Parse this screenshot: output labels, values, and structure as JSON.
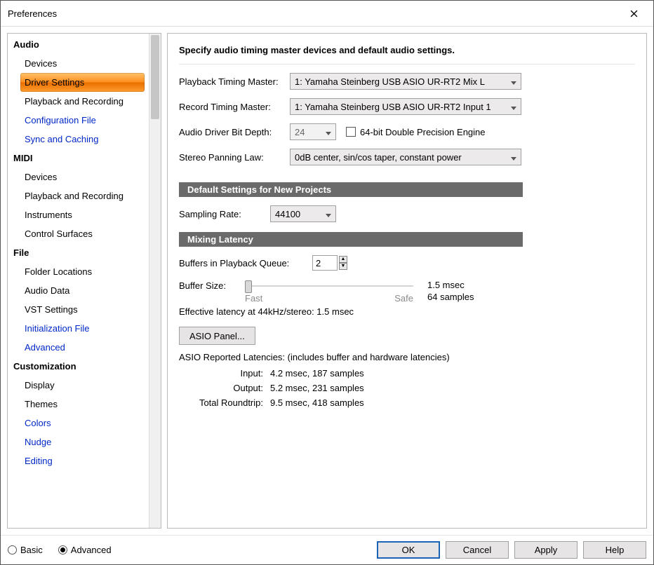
{
  "window": {
    "title": "Preferences"
  },
  "sidebar": {
    "sections": [
      {
        "header": "Audio",
        "items": [
          {
            "label": "Devices",
            "link": false,
            "selected": false
          },
          {
            "label": "Driver Settings",
            "link": false,
            "selected": true
          },
          {
            "label": "Playback and Recording",
            "link": false,
            "selected": false
          },
          {
            "label": "Configuration File",
            "link": true,
            "selected": false
          },
          {
            "label": "Sync and Caching",
            "link": true,
            "selected": false
          }
        ]
      },
      {
        "header": "MIDI",
        "items": [
          {
            "label": "Devices",
            "link": false,
            "selected": false
          },
          {
            "label": "Playback and Recording",
            "link": false,
            "selected": false
          },
          {
            "label": "Instruments",
            "link": false,
            "selected": false
          },
          {
            "label": "Control Surfaces",
            "link": false,
            "selected": false
          }
        ]
      },
      {
        "header": "File",
        "items": [
          {
            "label": "Folder Locations",
            "link": false,
            "selected": false
          },
          {
            "label": "Audio Data",
            "link": false,
            "selected": false
          },
          {
            "label": "VST Settings",
            "link": false,
            "selected": false
          },
          {
            "label": "Initialization File",
            "link": true,
            "selected": false
          },
          {
            "label": "Advanced",
            "link": true,
            "selected": false
          }
        ]
      },
      {
        "header": "Customization",
        "items": [
          {
            "label": "Display",
            "link": false,
            "selected": false
          },
          {
            "label": "Themes",
            "link": false,
            "selected": false
          },
          {
            "label": "Colors",
            "link": true,
            "selected": false
          },
          {
            "label": "Nudge",
            "link": true,
            "selected": false
          },
          {
            "label": "Editing",
            "link": true,
            "selected": false
          }
        ]
      }
    ]
  },
  "main": {
    "heading": "Specify audio timing master devices and default audio settings.",
    "playback_master": {
      "label": "Playback Timing Master:",
      "value": "1: Yamaha Steinberg USB ASIO UR-RT2 Mix L"
    },
    "record_master": {
      "label": "Record Timing Master:",
      "value": "1: Yamaha Steinberg USB ASIO UR-RT2 Input 1"
    },
    "bit_depth": {
      "label": "Audio Driver Bit Depth:",
      "value": "24"
    },
    "double_precision": {
      "label": "64-bit Double Precision Engine",
      "checked": false
    },
    "panning_law": {
      "label": "Stereo Panning Law:",
      "value": "0dB center, sin/cos taper, constant power"
    },
    "section_defaults": "Default Settings for New Projects",
    "sampling_rate": {
      "label": "Sampling Rate:",
      "value": "44100"
    },
    "section_latency": "Mixing Latency",
    "buffers_in_queue": {
      "label": "Buffers in Playback Queue:",
      "value": "2"
    },
    "buffer_size": {
      "label": "Buffer Size:",
      "fast": "Fast",
      "safe": "Safe",
      "info_time": "1.5 msec",
      "info_samples": "64 samples"
    },
    "effective_latency": "Effective latency at 44kHz/stereo:  1.5 msec",
    "asio_panel_btn": "ASIO Panel...",
    "reported_heading": "ASIO Reported Latencies: (includes buffer and hardware latencies)",
    "reported": {
      "input": {
        "label": "Input:",
        "value": "4.2 msec, 187 samples"
      },
      "output": {
        "label": "Output:",
        "value": "5.2 msec, 231 samples"
      },
      "total": {
        "label": "Total Roundtrip:",
        "value": "9.5 msec, 418 samples"
      }
    }
  },
  "footer": {
    "basic": "Basic",
    "advanced": "Advanced",
    "mode": "advanced",
    "ok": "OK",
    "cancel": "Cancel",
    "apply": "Apply",
    "help": "Help"
  }
}
